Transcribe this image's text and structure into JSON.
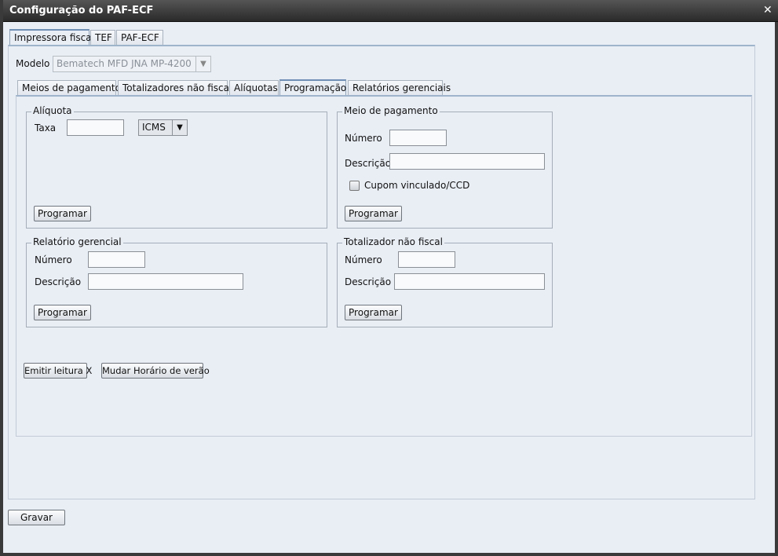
{
  "window": {
    "title": "Configuração do PAF-ECF",
    "close_icon": "close-icon"
  },
  "outer_tabs": [
    {
      "label": "Impressora fiscal",
      "selected": true
    },
    {
      "label": "TEF"
    },
    {
      "label": "PAF-ECF"
    }
  ],
  "modelo": {
    "label": "Modelo",
    "value": "Bematech MFD JNA MP-4200",
    "disabled": true
  },
  "inner_tabs": [
    {
      "label": "Meios de pagamento"
    },
    {
      "label": "Totalizadores não fiscais"
    },
    {
      "label": "Alíquotas"
    },
    {
      "label": "Programação",
      "selected": true
    },
    {
      "label": "Relatórios gerenciais"
    }
  ],
  "aliquota": {
    "legend": "Alíquota",
    "taxa_label": "Taxa",
    "taxa_value": "",
    "tipo_value": "ICMS",
    "button": "Programar"
  },
  "meio_pagamento": {
    "legend": "Meio de pagamento",
    "numero_label": "Número",
    "numero_value": "",
    "descricao_label": "Descrição",
    "descricao_value": "",
    "checkbox_label": "Cupom vinculado/CCD",
    "checkbox_checked": false,
    "button": "Programar"
  },
  "relatorio_gerencial": {
    "legend": "Relatório gerencial",
    "numero_label": "Número",
    "descricao_label": "Descrição",
    "button": "Programar"
  },
  "totalizador": {
    "legend": "Totalizador não fiscal",
    "numero_label": "Número",
    "descricao_label": "Descrição",
    "button": "Programar"
  },
  "actions": {
    "leitura_x": "Emitir leitura X",
    "horario_verao": "Mudar Horário de verão"
  },
  "footer": {
    "gravar": "Gravar"
  }
}
